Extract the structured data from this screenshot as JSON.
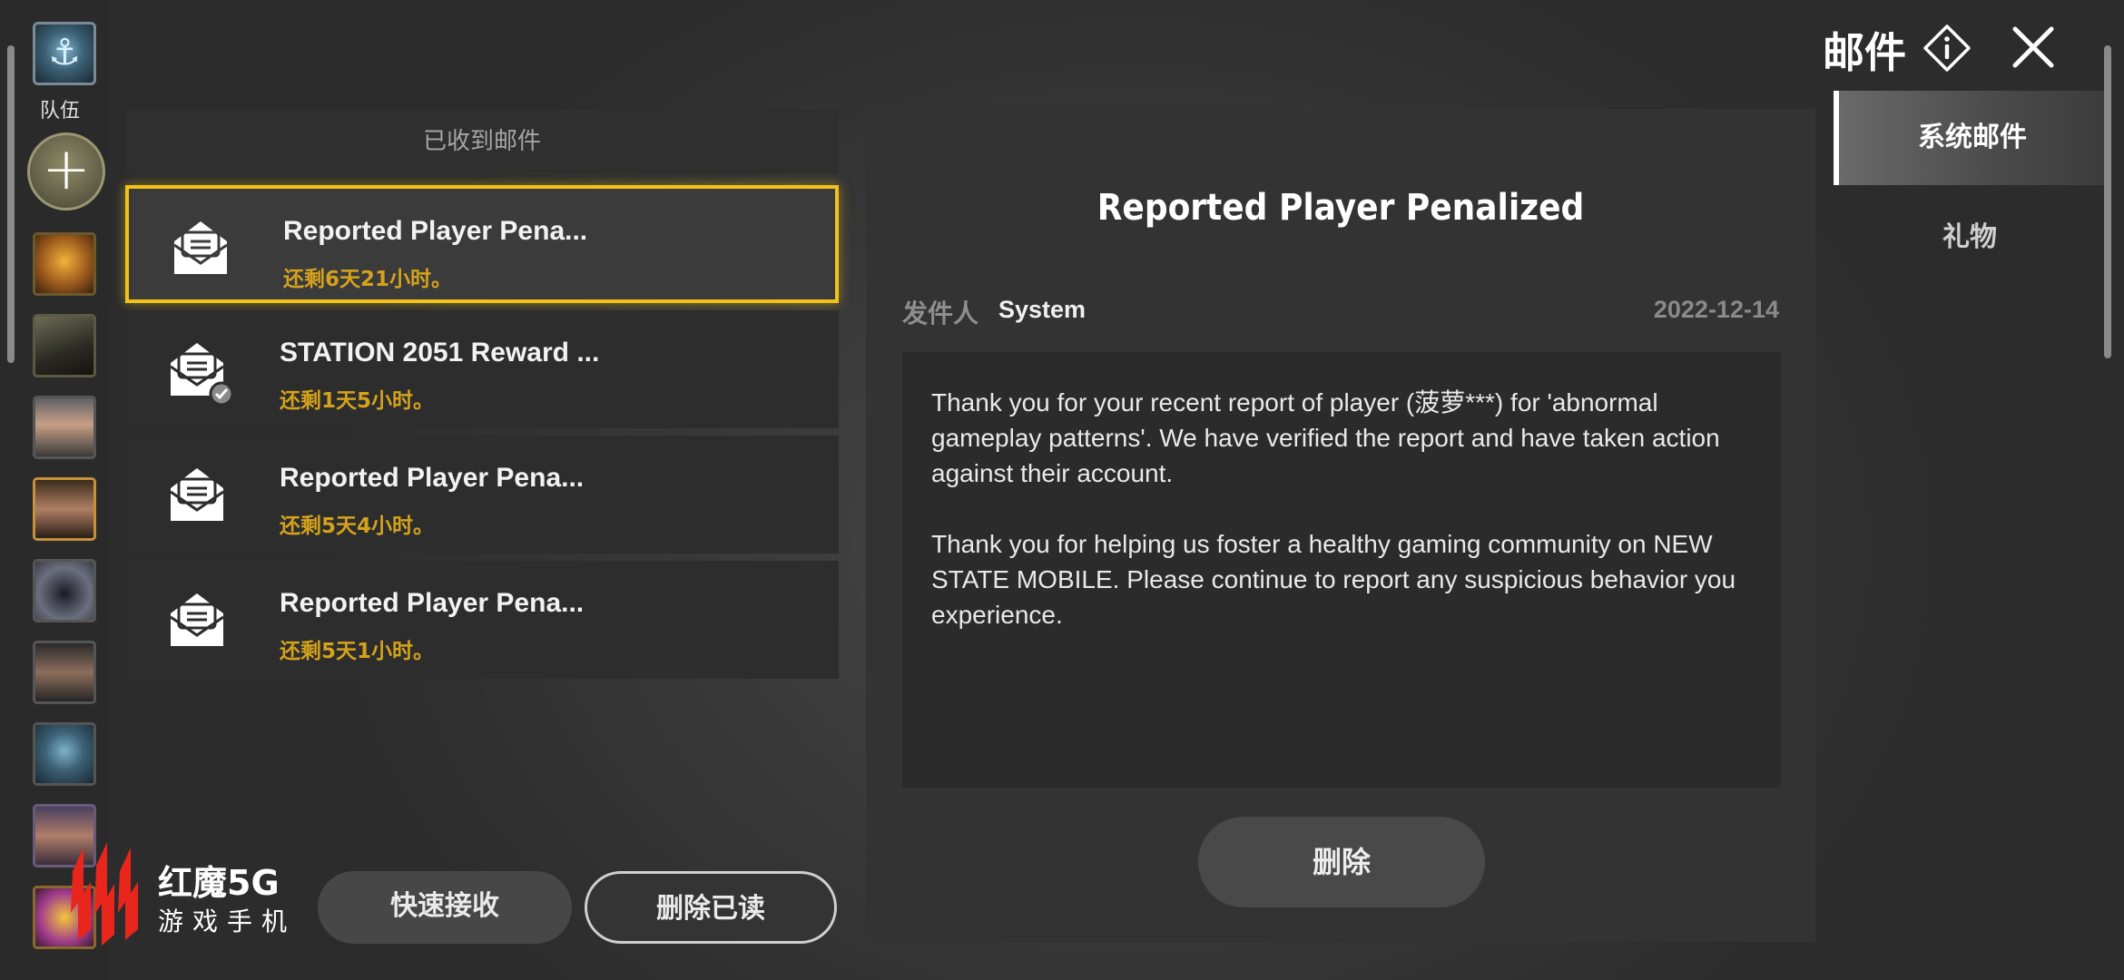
{
  "header": {
    "title": "邮件",
    "info_icon": "info-icon",
    "close_icon": "close-icon"
  },
  "team": {
    "label": "队伍",
    "add_icon": "plus-icon",
    "members_count_visible": 9
  },
  "mail_list": {
    "header": "已收到邮件",
    "items": [
      {
        "title": "Reported Player Pena...",
        "expires": "还剩6天21小时。",
        "selected": true,
        "read": false
      },
      {
        "title": "STATION 2051 Reward ...",
        "expires": "还剩1天5小时。",
        "selected": false,
        "read": true
      },
      {
        "title": "Reported Player Pena...",
        "expires": "还剩5天4小时。",
        "selected": false,
        "read": false
      },
      {
        "title": "Reported Player Pena...",
        "expires": "还剩5天1小时。",
        "selected": false,
        "read": false
      }
    ]
  },
  "actions": {
    "quick_receive": "快速接收",
    "delete_read": "删除已读"
  },
  "detail": {
    "title": "Reported Player Penalized",
    "sender_label": "发件人",
    "sender": "System",
    "date": "2022-12-14",
    "body": "Thank you for your recent report of player (菠萝***) for 'abnormal gameplay patterns'. We have verified the report and have taken action against their account.\n\nThank you for helping us foster a healthy gaming community on NEW STATE MOBILE. Please continue to report any suspicious behavior you experience.",
    "delete": "删除"
  },
  "tabs": [
    {
      "label": "系统邮件",
      "active": true
    },
    {
      "label": "礼物",
      "active": false
    }
  ],
  "watermark": {
    "line1": "红魔5G",
    "line2": "游戏手机"
  },
  "colors": {
    "accent_yellow": "#f2c21a",
    "expiry_text": "#d4a21c"
  }
}
